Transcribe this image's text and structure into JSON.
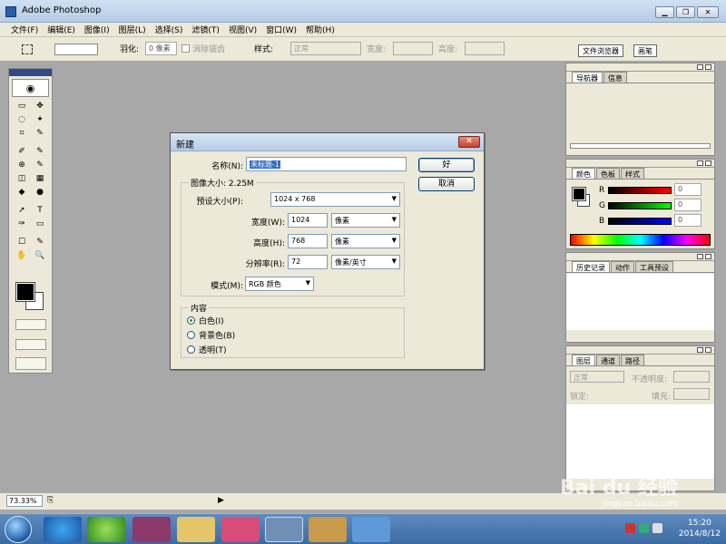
{
  "app": {
    "title": "Adobe Photoshop",
    "window_controls": {
      "minimize": "▁",
      "restore": "❐",
      "close": "✕"
    }
  },
  "menu": [
    "文件(F)",
    "编辑(E)",
    "图像(I)",
    "图层(L)",
    "选择(S)",
    "滤镜(T)",
    "视图(V)",
    "窗口(W)",
    "帮助(H)"
  ],
  "options": {
    "feather_label": "羽化:",
    "feather_value": "0 像素",
    "antialias_label": "消除锯齿",
    "style_label": "样式:",
    "style_value": "正常",
    "width_label": "宽度:",
    "height_label": "高度:",
    "tab_file_browser": "文件浏览器",
    "tab_brushes": "画笔"
  },
  "toolbox": {
    "tools": [
      "▭",
      "✥",
      "◌",
      "✦",
      "⌗",
      "✎",
      "✐",
      "✎",
      "⊕",
      "✎",
      "◫",
      "▦",
      "◆",
      "●",
      "➚",
      "T",
      "✑",
      "▭",
      "☐",
      "✎",
      "✋",
      "🔍"
    ]
  },
  "dialog": {
    "title": "新建",
    "close": "✕",
    "name_label": "名称(N):",
    "name_value": "未标题-1",
    "ok_label": "好",
    "cancel_label": "取消",
    "image_size_label": "图像大小: 2.25M",
    "preset_label": "预设大小(P):",
    "preset_value": "1024 x 768",
    "width_label": "宽度(W):",
    "width_value": "1024",
    "width_unit": "像素",
    "height_label": "高度(H):",
    "height_value": "768",
    "height_unit": "像素",
    "resolution_label": "分辨率(R):",
    "resolution_value": "72",
    "resolution_unit": "像素/英寸",
    "mode_label": "模式(M):",
    "mode_value": "RGB 颜色",
    "content_label": "内容",
    "contents": [
      {
        "label": "白色(I)",
        "selected": true
      },
      {
        "label": "背景色(B)",
        "selected": false
      },
      {
        "label": "透明(T)",
        "selected": false
      }
    ]
  },
  "panels": {
    "navigator": {
      "tabs": [
        "导航器",
        "信息"
      ]
    },
    "color": {
      "tabs": [
        "颜色",
        "色板",
        "样式"
      ],
      "r_label": "R",
      "g_label": "G",
      "b_label": "B",
      "r_value": "0",
      "g_value": "0",
      "b_value": "0"
    },
    "history": {
      "tabs": [
        "历史记录",
        "动作",
        "工具预设"
      ]
    },
    "layers": {
      "tabs": [
        "图层",
        "通道",
        "路径"
      ],
      "blend_value": "正常",
      "opacity_label": "不透明度:",
      "lock_label": "锁定:",
      "fill_label": "填充:"
    }
  },
  "status": {
    "zoom": "73.33%"
  },
  "taskbar": {
    "time": "15:20",
    "date": "2014/8/12",
    "watermark": "Bai du 经验",
    "watermark_url": "jingyan.baidu.com"
  },
  "colors": {
    "title_blue": "#b7cde6",
    "workspace_gray": "#a8a8a8",
    "chrome_beige": "#ece9d8",
    "selection_blue": "#316ac5"
  }
}
